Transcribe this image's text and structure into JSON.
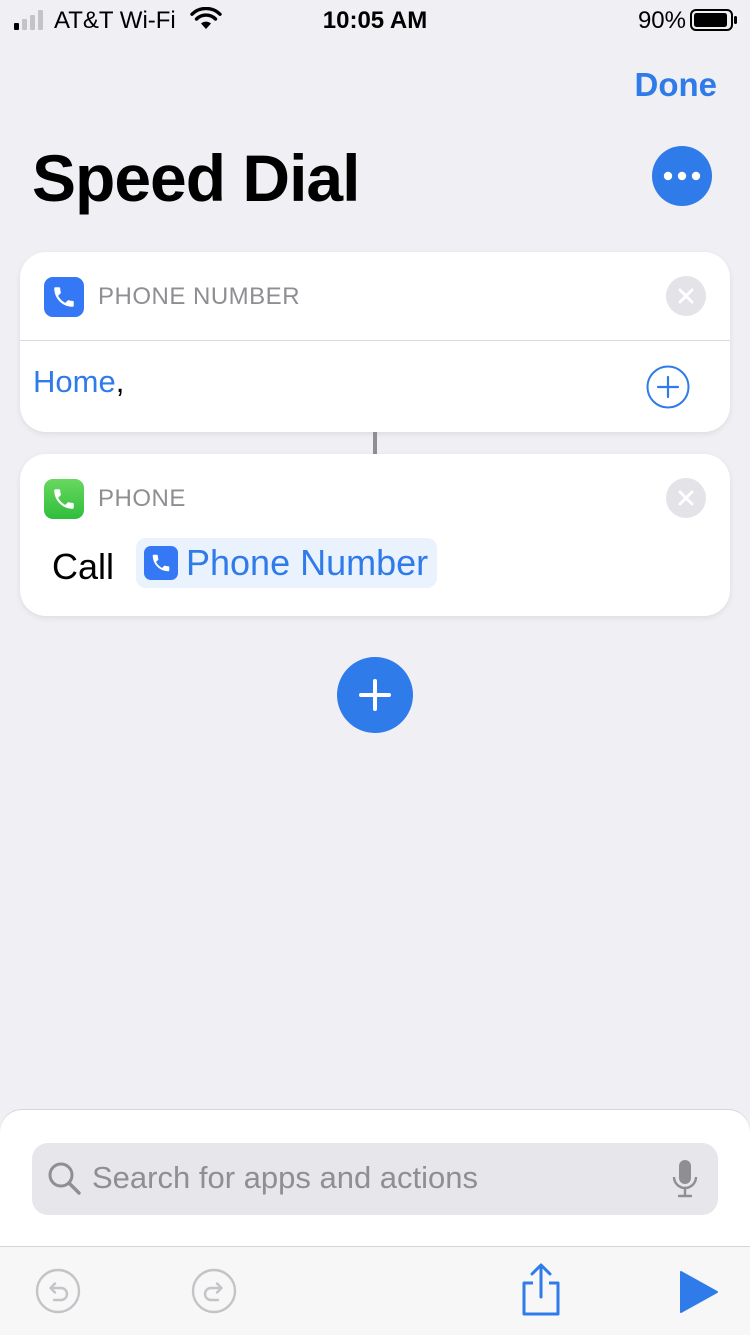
{
  "status_bar": {
    "carrier": "AT&T Wi-Fi",
    "time": "10:05 AM",
    "battery_percent": "90%"
  },
  "header": {
    "done_label": "Done",
    "title": "Speed Dial"
  },
  "actions": [
    {
      "label": "PHONE NUMBER",
      "icon": "phone-icon",
      "value": "Home",
      "value_suffix": ","
    },
    {
      "label": "PHONE",
      "icon": "phone-app-icon",
      "verb": "Call",
      "token": "Phone Number"
    }
  ],
  "search": {
    "placeholder": "Search for apps and actions"
  },
  "colors": {
    "accent": "#2f7bea",
    "background": "#efeff4",
    "phone_green": "#34c759"
  }
}
